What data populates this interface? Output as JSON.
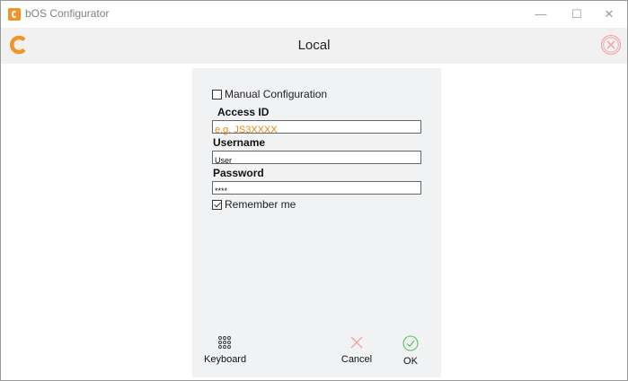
{
  "window": {
    "title": "bOS Configurator",
    "minimize_glyph": "—",
    "maximize_glyph": "☐",
    "close_glyph": "✕"
  },
  "header": {
    "title": "Local",
    "logo_icon": "bos-logo-icon",
    "close_icon": "close-circle-icon"
  },
  "form": {
    "manual_config_label": "Manual Configuration",
    "manual_config_checked": false,
    "access_id_label": "Access ID",
    "access_id_placeholder": "e.g. JS3XXXX",
    "access_id_value": "",
    "username_label": "Username",
    "username_value": "User",
    "password_label": "Password",
    "password_value": "****",
    "remember_me_label": "Remember me",
    "remember_me_checked": true
  },
  "actions": {
    "keyboard_label": "Keyboard",
    "cancel_label": "Cancel",
    "ok_label": "OK"
  },
  "colors": {
    "accent": "#f29427",
    "placeholder": "#e8861c",
    "cancel": "#f0a0a0",
    "ok": "#5cc05c",
    "header_bg": "#f1f1f1",
    "panel_bg": "#f1f2f4"
  }
}
